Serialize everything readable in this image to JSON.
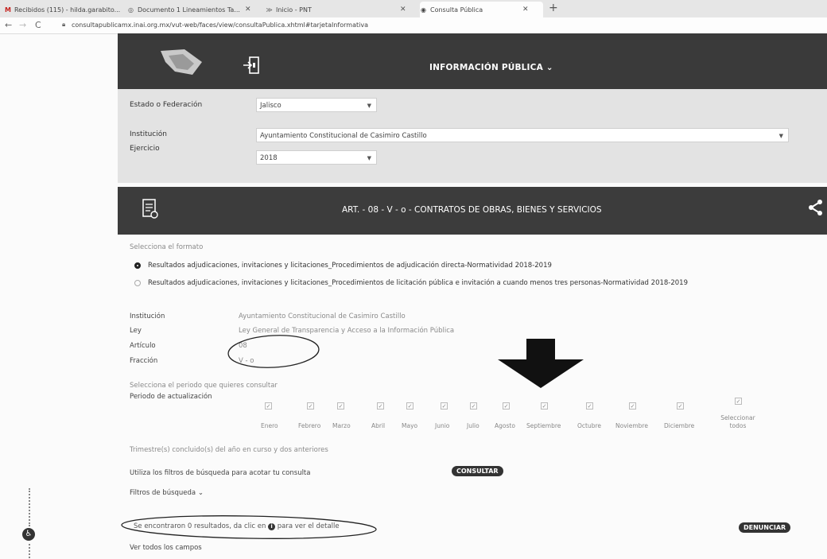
{
  "browser": {
    "tabs": [
      {
        "label": "Recibidos (115) - hilda.garabito...",
        "icon": "gmail-icon"
      },
      {
        "label": "Documento 1 Lineamientos Ta...",
        "icon": "docs-icon"
      },
      {
        "label": "Inicio - PNT",
        "icon": "pnt-icon"
      },
      {
        "label": "Consulta Pública",
        "icon": "globe-icon"
      }
    ],
    "url": "consultapublicamx.inai.org.mx/vut-web/faces/view/consultaPublica.xhtml#tarjetaInformativa"
  },
  "header": {
    "title": "INFORMACIÓN PÚBLICA"
  },
  "filters": {
    "state_label": "Estado o Federación",
    "state_value": "Jalisco",
    "institution_label": "Institución",
    "institution_value": "Ayuntamiento Constitucional de Casimiro Castillo",
    "year_label": "Ejercicio",
    "year_value": "2018"
  },
  "article": {
    "title": "ART. - 08 - V - o - CONTRATOS DE OBRAS, BIENES Y SERVICIOS"
  },
  "format": {
    "label": "Selecciona el formato",
    "options": [
      "Resultados adjudicaciones, invitaciones y licitaciones_Procedimientos de adjudicación directa-Normatividad 2018-2019",
      "Resultados adjudicaciones, invitaciones y licitaciones_Procedimientos de licitación pública e invitación a cuando menos tres personas-Normatividad 2018-2019"
    ]
  },
  "details": {
    "institution_label": "Institución",
    "institution_value": "Ayuntamiento Constitucional de Casimiro Castillo",
    "law_label": "Ley",
    "law_value": "Ley General de Transparencia y Acceso a la Información Pública",
    "article_label": "Artículo",
    "article_value": "08",
    "fraction_label": "Fracción",
    "fraction_value": "V - o"
  },
  "period": {
    "prompt": "Selecciona el periodo que quieres consultar",
    "label": "Periodo de actualización",
    "months": [
      "Enero",
      "Febrero",
      "Marzo",
      "Abril",
      "Mayo",
      "Junio",
      "Julio",
      "Agosto",
      "Septiembre",
      "Octubre",
      "Noviembre",
      "Diciembre"
    ],
    "select_all": "Seleccionar todos"
  },
  "quarter_note": "Trimestre(s) concluido(s) del año en curso y dos anteriores",
  "search_hint": "Utiliza los filtros de búsqueda para acotar tu consulta",
  "consult_button": "CONSULTAR",
  "search_filters": "Filtros de búsqueda",
  "results": {
    "text_before": "Se encontraron 0 resultados, da clic en",
    "text_after": "para ver el detalle"
  },
  "report_button": "DENUNCIAR",
  "view_all": "Ver todos los campos"
}
